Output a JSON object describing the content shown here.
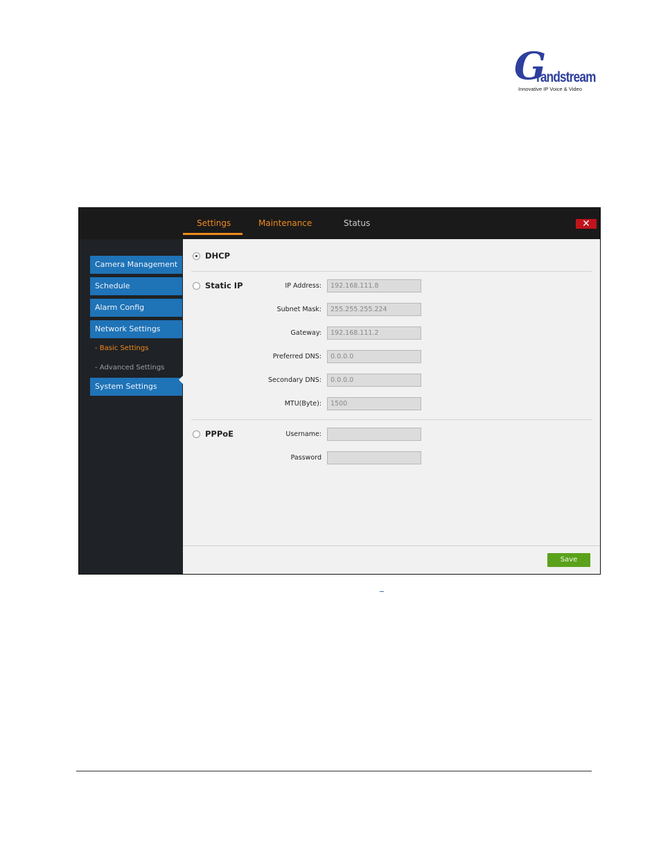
{
  "logo": {
    "word": "randstream",
    "tagline": "Innovative IP Voice & Video"
  },
  "tabs": [
    {
      "label": "Settings",
      "active": true
    },
    {
      "label": "Maintenance",
      "active": false
    },
    {
      "label": "Status",
      "active": false
    }
  ],
  "close_label": "✕",
  "sidebar": {
    "items": [
      {
        "label": "Camera Management"
      },
      {
        "label": "Schedule"
      },
      {
        "label": "Alarm Config"
      },
      {
        "label": "Network Settings"
      },
      {
        "label": "System Settings"
      }
    ],
    "sub_items": [
      {
        "label": "- Basic Settings",
        "active": true
      },
      {
        "label": "- Advanced Settings",
        "active": false
      }
    ]
  },
  "network": {
    "dhcp": {
      "label": "DHCP",
      "selected": true
    },
    "static_ip": {
      "label": "Static IP",
      "selected": false,
      "fields": [
        {
          "label": "IP Address:",
          "value": "192.168.111.8"
        },
        {
          "label": "Subnet Mask:",
          "value": "255.255.255.224"
        },
        {
          "label": "Gateway:",
          "value": "192.168.111.2"
        },
        {
          "label": "Preferred DNS:",
          "value": "0.0.0.0"
        },
        {
          "label": "Secondary DNS:",
          "value": "0.0.0.0"
        },
        {
          "label": "MTU(Byte):",
          "value": "1500"
        }
      ]
    },
    "pppoe": {
      "label": "PPPoE",
      "selected": false,
      "fields": [
        {
          "label": "Username:",
          "value": ""
        },
        {
          "label": "Password",
          "value": ""
        }
      ]
    }
  },
  "save_label": "Save",
  "caption_mark": "_",
  "colors": {
    "accent_orange": "#f08a1e",
    "nav_blue": "#1f73b7",
    "save_green": "#5aa21a",
    "close_red": "#c0141c",
    "logo_blue": "#2e3f9e"
  }
}
